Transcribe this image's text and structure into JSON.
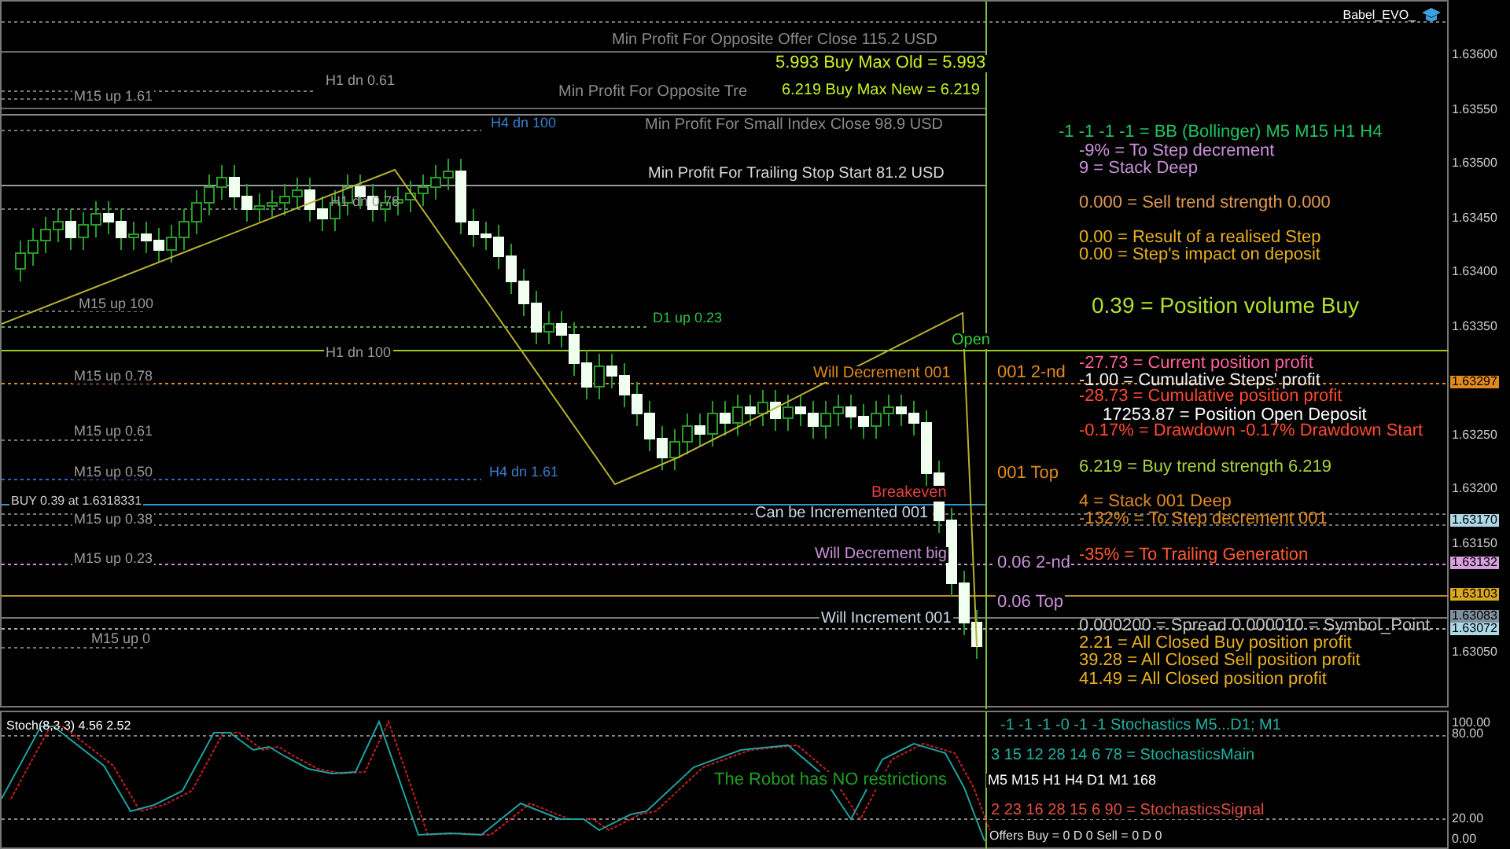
{
  "chart": {
    "title": "Babel_EVO_",
    "level_labels": [
      {
        "text": "Min Profit For Opposite Offer Close  115.2 USD",
        "color": "#8a8a8a"
      },
      {
        "text": "5.993 Buy Max Old = 5.993",
        "color": "#c8f020"
      },
      {
        "text": "H1 dn 0.61",
        "color": "#9a9a9a"
      },
      {
        "text": "M15 up 1.61",
        "color": "#9a9a9a"
      },
      {
        "text": "Min Profit For Opposite Tre",
        "color": "#8a8a8a"
      },
      {
        "text": "6.219 Buy Max New = 6.219",
        "color": "#c8f020"
      },
      {
        "text": "H4 dn 100",
        "color": "#3b7fd0"
      },
      {
        "text": "Min Profit For Small Index Close  98.9 USD",
        "color": "#8a8a8a"
      },
      {
        "text": "Min Profit For Trailing Stop Start 81.2 USD",
        "color": "#d8d8d8"
      },
      {
        "text": "H1 dn 0.78",
        "color": "#9a9a9a"
      },
      {
        "text": "M15 up 100",
        "color": "#9a9a9a"
      },
      {
        "text": "D1 up 0.23",
        "color": "#30c040"
      },
      {
        "text": "H1 dn 100",
        "color": "#9a9a9a"
      },
      {
        "text": "Open",
        "color": "#30d040"
      },
      {
        "text": "M15 up 0.78",
        "color": "#9a9a9a"
      },
      {
        "text": "Will Decrement 001",
        "color": "#e08a20"
      },
      {
        "text": "001 2-nd",
        "color": "#e08a20"
      },
      {
        "text": "M15 up 0.61",
        "color": "#9a9a9a"
      },
      {
        "text": "M15 up 0.50",
        "color": "#9a9a9a"
      },
      {
        "text": "H4 dn 1.61",
        "color": "#3b7fd0"
      },
      {
        "text": "001 Top",
        "color": "#e08a20"
      },
      {
        "text": "Breakeven",
        "color": "#e04040"
      },
      {
        "text": "BUY 0.39 at 1.6318331",
        "color": "#d0d0d0"
      },
      {
        "text": "M15 up 0.38",
        "color": "#9a9a9a"
      },
      {
        "text": "Can be Incremented 001",
        "color": "#c8d8e8"
      },
      {
        "text": "M15 up 0.23",
        "color": "#9a9a9a"
      },
      {
        "text": "Will Decrement big",
        "color": "#c890d8"
      },
      {
        "text": "0.06 2-nd",
        "color": "#c890d8"
      },
      {
        "text": "0.06 Top",
        "color": "#c890d8"
      },
      {
        "text": "Will Increment 001",
        "color": "#c8d8e8"
      },
      {
        "text": "M15 up 0",
        "color": "#9a9a9a"
      }
    ],
    "info_lines": [
      {
        "text": "-1 -1 -1 -1 = BB (Bollinger) M5 M15 H1 H4",
        "color": "#20c060",
        "kind": "normal"
      },
      {
        "text": "-9% =  To Step decrement",
        "color": "#c890d8",
        "kind": "normal"
      },
      {
        "text": "9 =  Stack Deep",
        "color": "#c890d8",
        "kind": "normal"
      },
      {
        "text": "0.000 = Sell trend strength 0.000",
        "color": "#e09a50",
        "kind": "normal"
      },
      {
        "text": "0.00 = Result of a realised Step",
        "color": "#e8b020",
        "kind": "normal"
      },
      {
        "text": "0.00 = Step's impact on deposit",
        "color": "#e8b020",
        "kind": "normal"
      },
      {
        "text": "0.39 = Position volume Buy",
        "color": "#b0e030",
        "kind": "large"
      },
      {
        "text": "-27.73 = Current position profit",
        "color": "#ff60a0",
        "kind": "normal"
      },
      {
        "text": "-1.00 = Cumulative Steps' profit",
        "color": "#f0f0f0",
        "kind": "normal"
      },
      {
        "text": "-28.73 = Cumulative position profit",
        "color": "#ff4a30",
        "kind": "normal"
      },
      {
        "text": "17253.87 = Position Open Deposit",
        "color": "#ffffff",
        "kind": "normal"
      },
      {
        "text": "-0.17% = Drawdown   -0.17%  Drawdown Start",
        "color": "#ff4a30",
        "kind": "normal"
      },
      {
        "text": "6.219 = Buy trend strength 6.219",
        "color": "#a8d040",
        "kind": "normal"
      },
      {
        "text": "4 =  Stack 001 Deep",
        "color": "#e08a20",
        "kind": "normal"
      },
      {
        "text": "-132% =  To Step decrement 001",
        "color": "#e08a20",
        "kind": "normal"
      },
      {
        "text": "-35% =  To Trailing Generation",
        "color": "#ff5a30",
        "kind": "normal"
      },
      {
        "text": "0.000200 = Spread   0.000010 = Symbol_Point",
        "color": "#c0c0c0",
        "kind": "normal"
      },
      {
        "text": "2.21 =  All Closed Buy position profit",
        "color": "#e8b020",
        "kind": "normal"
      },
      {
        "text": "39.28 =  All Closed Sell position profit",
        "color": "#e8b020",
        "kind": "normal"
      },
      {
        "text": "41.49 =  All Closed position profit",
        "color": "#e8b020",
        "kind": "normal"
      }
    ],
    "price_axis": [
      {
        "text": "1.63600"
      },
      {
        "text": "1.63550"
      },
      {
        "text": "1.63500"
      },
      {
        "text": "1.63450"
      },
      {
        "text": "1.63400"
      },
      {
        "text": "1.63350"
      },
      {
        "text": "1.63297",
        "color": "#e08a20"
      },
      {
        "text": "1.63250"
      },
      {
        "text": "1.63200"
      },
      {
        "text": "1.63170",
        "color": "#add8e6"
      },
      {
        "text": "1.63150"
      },
      {
        "text": "1.63132",
        "color": "#d8a0e0"
      },
      {
        "text": "1.63103",
        "color": "#d8a820"
      },
      {
        "text": "1.63083",
        "color": "#8090a0"
      },
      {
        "text": "1.63072",
        "color": "#add8e6"
      },
      {
        "text": "1.63050"
      }
    ]
  },
  "indicator": {
    "title": "Stoch(8,3,3) 4.56 2.52",
    "lines": [
      {
        "text": "-1  -1  -1  -0  -1  -1   Stochastics M5...D1; M1",
        "color": "#20b0a0"
      },
      {
        "text": "3  15  12  28  14  6  78 = StochasticsMain",
        "color": "#20b0a0"
      },
      {
        "text": "The Robot has NO restrictions",
        "color": "#20a020"
      },
      {
        "text": "M5  M15 H1  H4  D1  M1  168",
        "color": "#ffffff"
      },
      {
        "text": "2  23  16  28  15  6  90 = StochasticsSignal",
        "color": "#e05040"
      },
      {
        "text": "Offers Buy = 0 D 0  Sell = 0 D 0",
        "color": "#e0e0e0"
      }
    ],
    "axis": [
      {
        "text": "100.00"
      },
      {
        "text": "80.00"
      },
      {
        "text": "20.00"
      },
      {
        "text": "0.00"
      }
    ]
  }
}
